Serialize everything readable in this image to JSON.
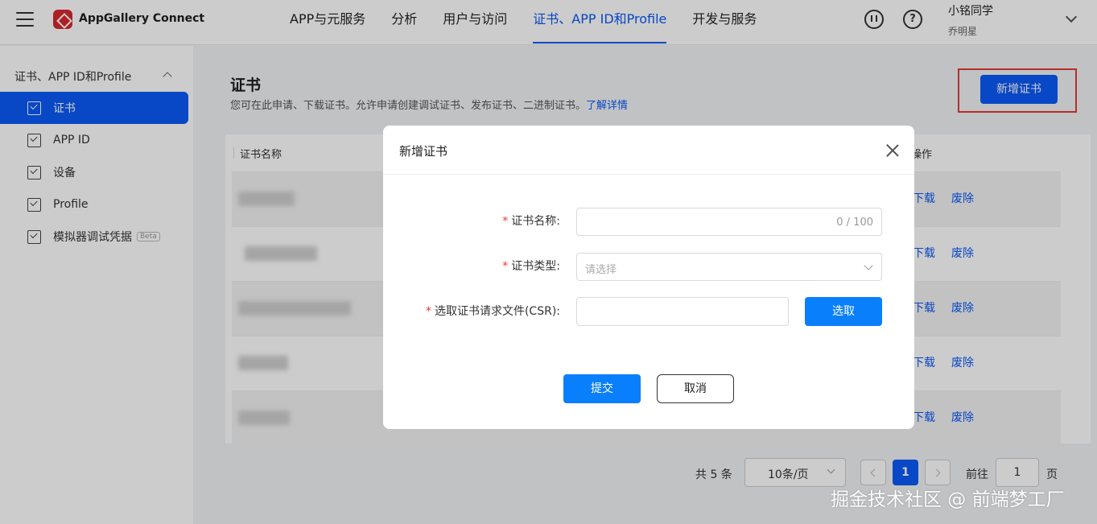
{
  "header": {
    "brand": "AppGallery Connect",
    "nav": [
      {
        "label": "APP与元服务",
        "active": false
      },
      {
        "label": "分析",
        "active": false
      },
      {
        "label": "用户与访问",
        "active": false
      },
      {
        "label": "证书、APP ID和Profile",
        "active": true
      },
      {
        "label": "开发与服务",
        "active": false
      }
    ],
    "user_name": "小铭同学",
    "user_org": "乔明星"
  },
  "sidebar": {
    "group_label": "证书、APP ID和Profile",
    "items": [
      {
        "label": "证书",
        "active": true
      },
      {
        "label": "APP ID",
        "active": false
      },
      {
        "label": "设备",
        "active": false
      },
      {
        "label": "Profile",
        "active": false
      },
      {
        "label": "模拟器调试凭据",
        "active": false,
        "badge": "Beta"
      }
    ]
  },
  "page": {
    "title": "证书",
    "description": "您可在此申请、下载证书。允许申请创建调试证书、发布证书、二进制证书。",
    "learn_more": "了解详情",
    "add_button": "新增证书"
  },
  "table": {
    "columns": [
      "证书名称",
      "操作"
    ],
    "row_actions": [
      "下载",
      "废除"
    ],
    "row_count": 5
  },
  "pagination": {
    "total": "共 5 条",
    "page_size": "10条/页",
    "current_page": "1",
    "goto_label": "前往",
    "goto_value": "1",
    "page_suffix": "页"
  },
  "modal": {
    "title": "新增证书",
    "fields": {
      "name_label": "证书名称:",
      "name_counter": "0 / 100",
      "type_label": "证书类型:",
      "type_placeholder": "请选择",
      "csr_label": "选取证书请求文件(CSR):",
      "select_button": "选取"
    },
    "submit_button": "提交",
    "cancel_button": "取消",
    "required_mark": "*"
  },
  "watermark": "掘金技术社区 @ 前端梦工厂",
  "colors": {
    "accent": "#0a59f7",
    "modal_button": "#0a7ffb",
    "required": "#e53935",
    "highlight_box": "#e53935"
  }
}
